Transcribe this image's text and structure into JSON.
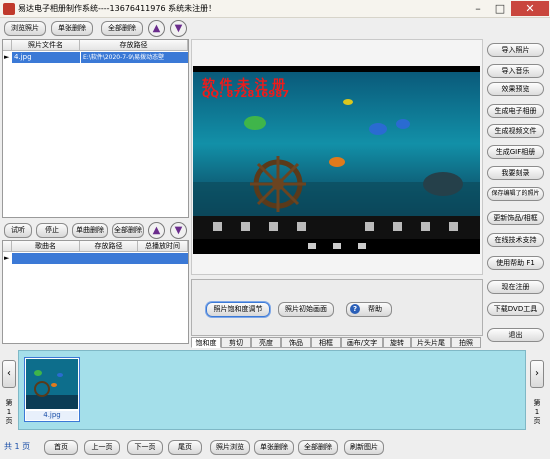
{
  "window": {
    "title": "易达电子相册制作系统----13676411976  系统未注册！"
  },
  "toolbar": {
    "browse": "浏览照片",
    "delete_one": "单张删除",
    "delete_all": "全部删除"
  },
  "photo_table": {
    "headers": [
      "照片文件名",
      "存放路径"
    ],
    "rows": [
      {
        "name": "4.jpg",
        "path": "E:\\软件\\2020-7-9\\易拨动态壁"
      }
    ]
  },
  "music_toolbar": {
    "preview": "试听",
    "stop": "停止",
    "delete_one": "单曲删除",
    "delete_all": "全部删除"
  },
  "music_table": {
    "headers": [
      "歌曲名",
      "存放路径",
      "总播放时间"
    ]
  },
  "preview": {
    "watermark_line1": "软 件 未 注 册",
    "watermark_line2": "QQ: 872816987"
  },
  "saturation_panel": {
    "adjust": "照片饱和度调节",
    "reset": "照片初始画面",
    "help": "帮助"
  },
  "tabs": [
    "饱和度",
    "剪切",
    "亮度",
    "饰品",
    "相框",
    "画布/文字",
    "旋转",
    "片头片尾",
    "拍照"
  ],
  "right_buttons": [
    "导入照片",
    "导入音乐",
    "效果预览",
    "生成电子相册",
    "生成视频文件",
    "生成GIF相册",
    "我要刻录",
    "保存编辑了的照片",
    "更新饰品/相框",
    "在线技术支持",
    "使用帮助  F1",
    "现在注册",
    "下载DVD工具",
    "退出"
  ],
  "filmstrip": {
    "left_label": [
      "第",
      "1",
      "页"
    ],
    "right_label": [
      "第",
      "1",
      "页"
    ],
    "thumbs": [
      {
        "caption": "4.jpg"
      }
    ]
  },
  "bottom": {
    "page_count": "共 1 页",
    "buttons": [
      "首页",
      "上一页",
      "下一页",
      "尾页",
      "照片浏览",
      "单张删除",
      "全部删除",
      "刷新图片"
    ]
  },
  "colors": {
    "accent": "#3b79d6",
    "filmstrip_bg": "#a4dfea",
    "watermark": "#ee1b1b"
  }
}
